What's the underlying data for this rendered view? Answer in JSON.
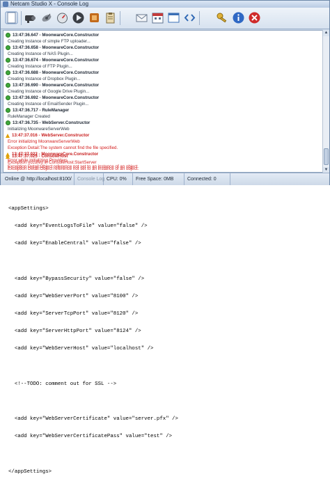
{
  "window": {
    "title": "Netcam Studio X - Console Log"
  },
  "toolbar": {
    "buttons": [
      {
        "icon": "document-icon"
      },
      {
        "icon": "camera-icon"
      },
      {
        "icon": "satellite-icon"
      },
      {
        "icon": "gauge-icon"
      },
      {
        "icon": "play-icon"
      },
      {
        "icon": "plugin-icon"
      },
      {
        "icon": "clipboard-icon"
      },
      {
        "icon": "mail-icon"
      },
      {
        "icon": "calendar-icon"
      },
      {
        "icon": "window-icon"
      },
      {
        "icon": "code-icon"
      },
      {
        "icon": "keys-icon"
      },
      {
        "icon": "info-icon"
      },
      {
        "icon": "close-icon"
      }
    ]
  },
  "log": {
    "entries": [
      {
        "time": "",
        "source": "",
        "message": "",
        "level": "info"
      },
      {
        "time": "13:47:36.647",
        "source": "MoonwareCore.Constructor",
        "message": "Creating Instance of simple FTP uploader...",
        "level": "info"
      },
      {
        "time": "13:47:36.658",
        "source": "MoonwareCore.Constructor",
        "message": "Creating Instance of NAS Plugin...",
        "level": "info"
      },
      {
        "time": "13:47:36.674",
        "source": "MoonwareCore.Constructor",
        "message": "Creating Instance of FTP Plugin...",
        "level": "info"
      },
      {
        "time": "13:47:36.688",
        "source": "MoonwareCore.Constructor",
        "message": "Creating Instance of Dropbox Plugin...",
        "level": "info"
      },
      {
        "time": "13:47:36.690",
        "source": "MoonwareCore.Constructor",
        "message": "Creating Instance of Google Drive Plugin...",
        "level": "info"
      },
      {
        "time": "13:47:36.692",
        "source": "MoonwareCore.Constructor",
        "message": "Creating Instance of EmailSender Plugin...",
        "level": "info"
      },
      {
        "time": "13:47:36.717",
        "source": "RuleManager",
        "message": "RuleManager Created",
        "level": "info"
      },
      {
        "time": "13:47:36.735",
        "source": "WebServer.Constructor",
        "message": "Initializing MoonwareServerWeb",
        "level": "info"
      },
      {
        "time": "13:47:37.016",
        "source": "WebServer.Constructor",
        "message": "Error initializing MoonwareServerWeb",
        "message2": "Exception Detail:The system cannot find the file specified.",
        "level": "error"
      },
      {
        "time": "13:47:37.022",
        "source": "MoonwareCore.Constructor",
        "message": "Error while initializing Providers",
        "message2": "Exception Detail:Object reference not set to an instance of an object.",
        "level": "error"
      },
      {
        "time": "13:47:37.025",
        "source": "ConsoleHost",
        "message": "Exception occured in ConsoleHost:StartServer",
        "message2": "Exception Detail:Object reference not set to an instance of an object.",
        "level": "error"
      }
    ]
  },
  "status": {
    "online": "Online @ http://localhost:8100/",
    "console_log": "Console Log",
    "cpu": "CPU: 0%",
    "free_space": "Free Space: 0MB",
    "connected": "Connected: 0"
  },
  "code_lines": [
    "<appSettings>",
    "  <add key=\"EventLogsToFile\" value=\"false\" />",
    "  <add key=\"EnableCentral\" value=\"false\" />",
    "",
    "  <add key=\"BypassSecurity\" value=\"false\" />",
    "  <add key=\"WebServerPort\" value=\"8100\" />",
    "  <add key=\"ServerTcpPort\" value=\"8120\" />",
    "  <add key=\"ServerHttpPort\" value=\"8124\" />",
    "  <add key=\"WebServerHost\" value=\"localhost\" />",
    "",
    "  <!--TODO: comment out for SSL -->",
    "",
    "  <add key=\"WebServerCertificate\" value=\"server.pfx\" />",
    "  <add key=\"WebServerCertificatePass\" value=\"test\" />",
    "",
    "</appSettings>"
  ]
}
